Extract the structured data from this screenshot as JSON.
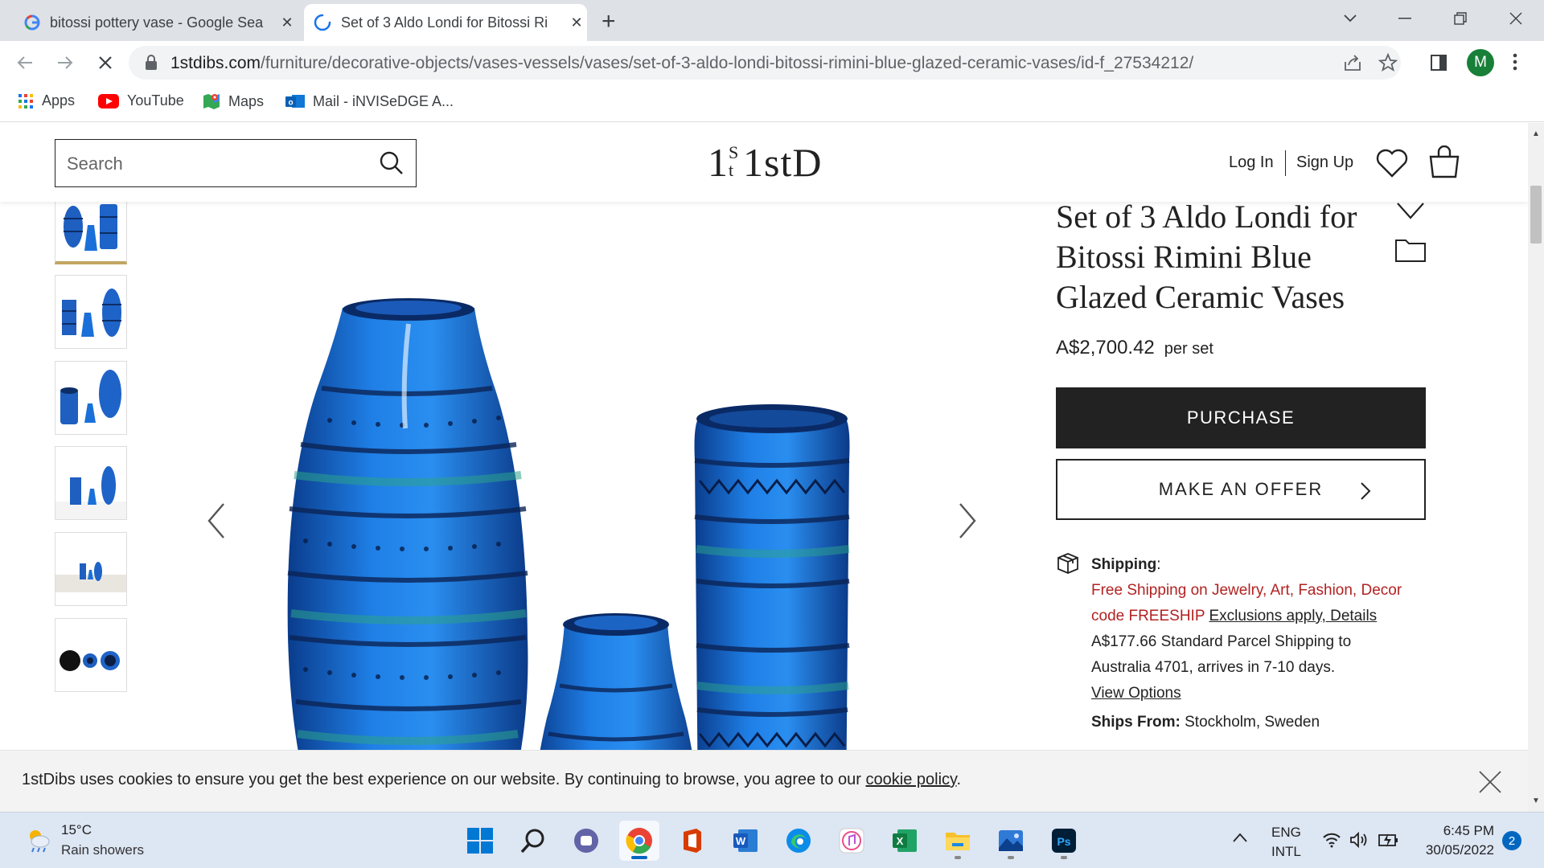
{
  "browser": {
    "tabs": [
      {
        "title": "bitossi pottery vase - Google Sea",
        "active": false,
        "icon": "google-icon"
      },
      {
        "title": "Set of 3 Aldo Londi for Bitossi Ri",
        "active": true,
        "icon": "loading-spinner-icon"
      }
    ],
    "url_host": "1stdibs.com",
    "url_path": "/furniture/decorative-objects/vases-vessels/vases/set-of-3-aldo-londi-bitossi-rimini-blue-glazed-ceramic-vases/id-f_27534212/",
    "profile_initial": "M",
    "bookmarks": [
      {
        "label": "Apps",
        "icon": "apps-grid-icon"
      },
      {
        "label": "YouTube",
        "icon": "youtube-icon"
      },
      {
        "label": "Maps",
        "icon": "maps-icon"
      },
      {
        "label": "Mail - iNVISeDGE A...",
        "icon": "outlook-icon"
      }
    ]
  },
  "site": {
    "search_placeholder": "Search",
    "logo": "1stDIBS",
    "login": "Log In",
    "signup": "Sign Up"
  },
  "product": {
    "title": "Set of 3 Aldo Londi for Bitossi Rimini Blue Glazed Ceramic Vases",
    "price": "A$2,700.42",
    "price_unit": "per set",
    "purchase_label": "PURCHASE",
    "offer_label": "MAKE AN OFFER",
    "thumbnail_count": 6,
    "selected_thumbnail": 1
  },
  "shipping": {
    "heading": "Shipping",
    "promo_line1": "Free Shipping on Jewelry, Art, Fashion, Decor",
    "promo_code": "code FREESHIP",
    "exclusions_link": "Exclusions apply, Details",
    "standard_line1": "A$177.66 Standard Parcel Shipping to",
    "standard_line2": "Australia 4701, arrives in 7-10 days.",
    "view_options": "View Options",
    "ships_from_label": "Ships From:",
    "ships_from_value": "Stockholm, Sweden"
  },
  "cookie": {
    "text": "1stDibs uses cookies to ensure you get the best experience on our website. By continuing to browse, you agree to our",
    "link": "cookie policy",
    "end": "."
  },
  "taskbar": {
    "weather_temp": "15°C",
    "weather_desc": "Rain showers",
    "lang_line1": "ENG",
    "lang_line2": "INTL",
    "time": "6:45 PM",
    "date": "30/05/2022",
    "notification_count": "2"
  },
  "colors": {
    "accent_gold": "#c2a661",
    "promo_red": "#b22222",
    "vase_blue": "#1e6fd0"
  }
}
